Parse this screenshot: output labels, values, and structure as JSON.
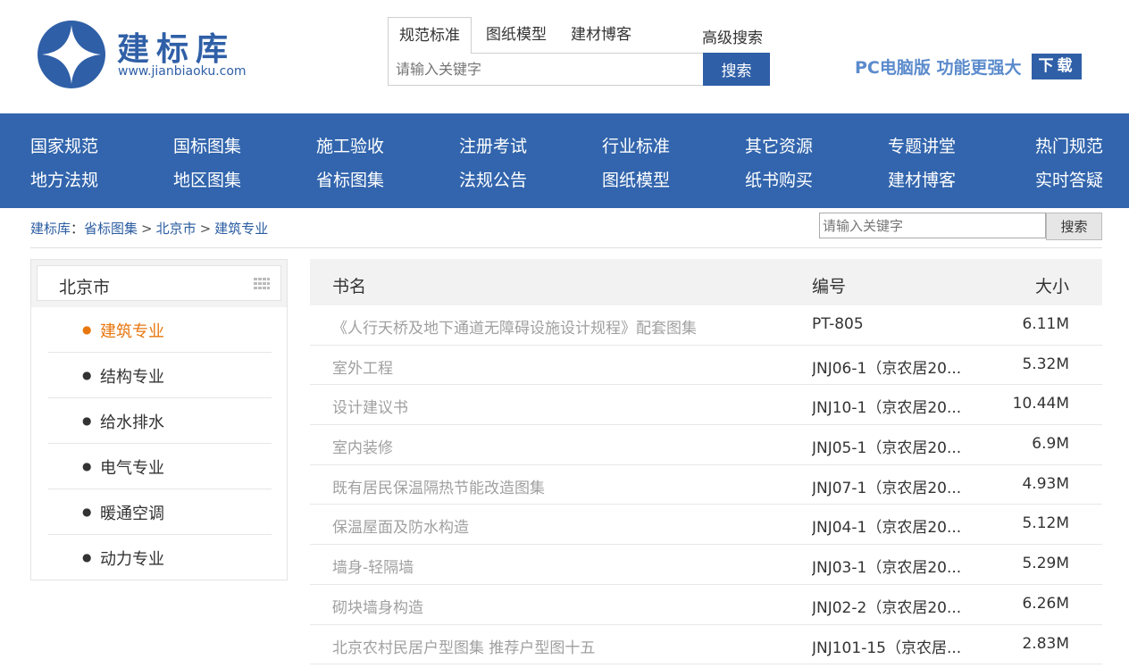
{
  "header": {
    "logo_name": "建标库",
    "logo_url": "www.jianbiaoku.com",
    "search_tabs": [
      "规范标准",
      "图纸模型",
      "建材博客"
    ],
    "advanced_search": "高级搜索",
    "search_placeholder": "请输入关键字",
    "search_button": "搜索",
    "promo_text": "PC电脑版  功能更强大",
    "promo_download": "下载"
  },
  "nav": {
    "row1": [
      "国家规范",
      "国标图集",
      "施工验收",
      "注册考试",
      "行业标准",
      "其它资源",
      "专题讲堂",
      "热门规范"
    ],
    "row2": [
      "地方法规",
      "地区图集",
      "省标图集",
      "法规公告",
      "图纸模型",
      "纸书购买",
      "建材博客",
      "实时答疑"
    ]
  },
  "breadcrumb": {
    "root": "建标库",
    "items": [
      "省标图集",
      "北京市",
      "建筑专业"
    ],
    "search_placeholder": "请输入关键字",
    "search_button": "搜索"
  },
  "sidebar": {
    "title": "北京市",
    "items": [
      "建筑专业",
      "结构专业",
      "给水排水",
      "电气专业",
      "暖通空调",
      "动力专业"
    ],
    "active_index": 0
  },
  "table": {
    "headers": [
      "书名",
      "编号",
      "大小"
    ],
    "rows": [
      {
        "name": "《人行天桥及地下通道无障碍设施设计规程》配套图集",
        "code": "PT-805",
        "size": "6.11M"
      },
      {
        "name": "室外工程",
        "code": "JNJ06-1（京农居20...",
        "size": "5.32M"
      },
      {
        "name": "设计建议书",
        "code": "JNJ10-1（京农居20...",
        "size": "10.44M"
      },
      {
        "name": "室内装修",
        "code": "JNJ05-1（京农居20...",
        "size": "6.9M"
      },
      {
        "name": "既有居民保温隔热节能改造图集",
        "code": "JNJ07-1（京农居20...",
        "size": "4.93M"
      },
      {
        "name": "保温屋面及防水构造",
        "code": "JNJ04-1（京农居20...",
        "size": "5.12M"
      },
      {
        "name": "墙身-轻隔墙",
        "code": "JNJ03-1（京农居20...",
        "size": "5.29M"
      },
      {
        "name": "砌块墙身构造",
        "code": "JNJ02-2（京农居20...",
        "size": "6.26M"
      },
      {
        "name": "北京农村民居户型图集 推荐户型图十五",
        "code": "JNJ101-15（京农居...",
        "size": "2.83M"
      }
    ]
  },
  "colors": {
    "brand_blue": "#3265ad",
    "active_orange": "#e8770f",
    "link_blue": "#2a5ca1"
  }
}
